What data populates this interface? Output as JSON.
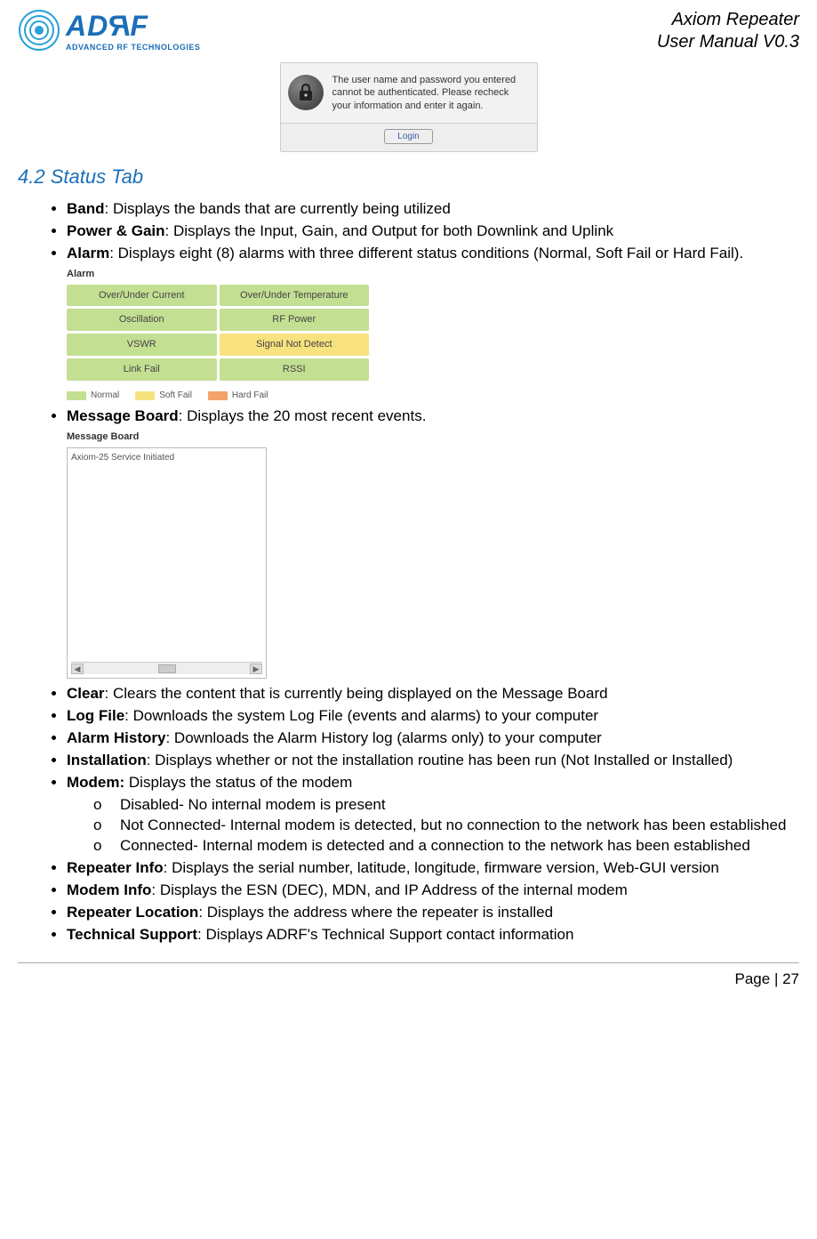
{
  "header": {
    "logo_main_a": "AD",
    "logo_main_r": "R",
    "logo_main_z": "F",
    "logo_sub": "ADVANCED RF TECHNOLOGIES",
    "line1": "Axiom Repeater",
    "line2": "User Manual V0.3"
  },
  "login": {
    "message": "The user name and password you entered cannot be authenticated. Please recheck your information and enter it again.",
    "button": "Login"
  },
  "section": {
    "title": "4.2 Status Tab"
  },
  "bullets": {
    "band": {
      "term": "Band",
      "text": ": Displays the bands that are currently being utilized"
    },
    "power_gain": {
      "term": "Power & Gain",
      "text": ": Displays the Input, Gain, and Output for both Downlink and Uplink"
    },
    "alarm": {
      "term": "Alarm",
      "text": ": Displays eight (8) alarms with three different status conditions (Normal, Soft Fail or Hard Fail)."
    },
    "message_board": {
      "term": "Message Board",
      "text": ": Displays the 20 most recent events."
    },
    "clear": {
      "term": "Clear",
      "text": ": Clears the content that is currently being displayed on the Message Board"
    },
    "log_file": {
      "term": "Log File",
      "text": ": Downloads the system Log File (events and alarms) to your computer"
    },
    "alarm_history": {
      "term": "Alarm History",
      "text": ": Downloads the Alarm History log (alarms only) to your computer"
    },
    "installation": {
      "term": "Installation",
      "text": ": Displays whether or not the installation routine has been run (Not Installed or Installed)"
    },
    "modem": {
      "term": "Modem:",
      "text": " Displays the status of the modem"
    },
    "modem_sub": {
      "a": "Disabled- No internal modem is present",
      "b": "Not Connected- Internal modem is detected, but no connection to the network has been established",
      "c": "Connected- Internal modem is detected and a connection to the network has been established"
    },
    "repeater_info": {
      "term": "Repeater Info",
      "text": ": Displays the serial number, latitude, longitude, firmware version, Web-GUI version"
    },
    "modem_info": {
      "term": "Modem Info",
      "text": ": Displays the ESN (DEC), MDN, and IP Address of the internal modem"
    },
    "repeater_location": {
      "term": "Repeater Location",
      "text": ": Displays the address where the repeater is installed"
    },
    "technical_support": {
      "term": "Technical Support",
      "text": ": Displays ADRF's Technical Support contact information"
    }
  },
  "alarm_panel": {
    "title": "Alarm",
    "cells": [
      {
        "label": "Over/Under Current",
        "status": "normal"
      },
      {
        "label": "Over/Under Temperature",
        "status": "normal"
      },
      {
        "label": "Oscillation",
        "status": "normal"
      },
      {
        "label": "RF Power",
        "status": "normal"
      },
      {
        "label": "VSWR",
        "status": "normal"
      },
      {
        "label": "Signal Not Detect",
        "status": "soft_fail"
      },
      {
        "label": "Link Fail",
        "status": "normal"
      },
      {
        "label": "RSSI",
        "status": "normal"
      }
    ],
    "legend": {
      "normal": "Normal",
      "soft_fail": "Soft Fail",
      "hard_fail": "Hard Fail"
    }
  },
  "msg_board": {
    "title": "Message Board",
    "content": "Axiom-25 Service Initiated"
  },
  "sub_marker": "o",
  "footer": {
    "page": "Page | 27"
  }
}
